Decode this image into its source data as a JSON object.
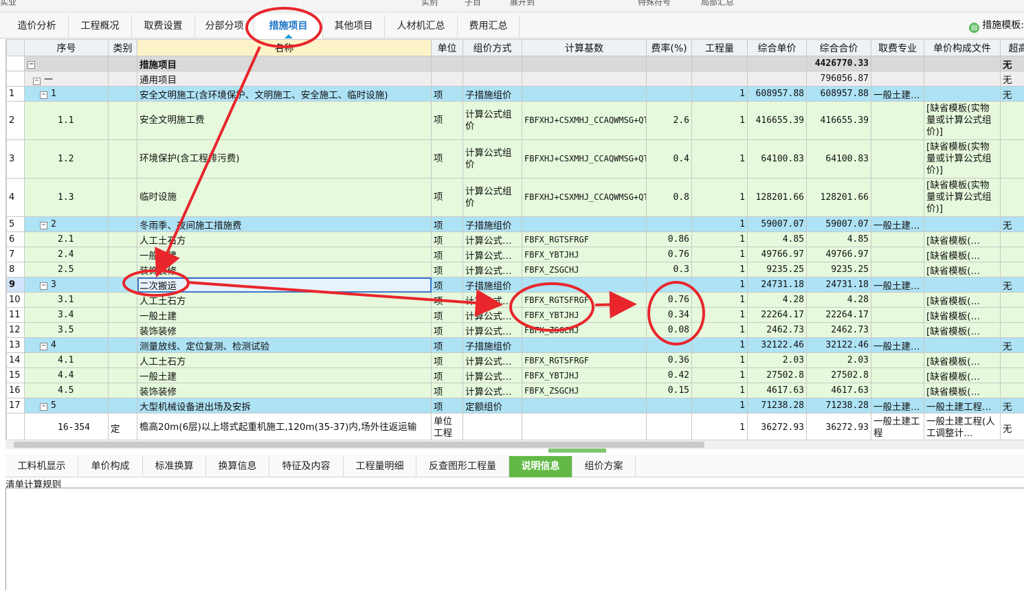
{
  "topbar": {
    "items": [
      "实业",
      "实别",
      "子目",
      "展开到",
      "特殊符号",
      "局部汇总"
    ]
  },
  "tabs": [
    {
      "label": "造价分析",
      "active": false
    },
    {
      "label": "工程概况",
      "active": false
    },
    {
      "label": "取费设置",
      "active": false
    },
    {
      "label": "分部分项",
      "active": false
    },
    {
      "label": "措施项目",
      "active": true
    },
    {
      "label": "其他项目",
      "active": false
    },
    {
      "label": "人材机汇总",
      "active": false
    },
    {
      "label": "费用汇总",
      "active": false
    }
  ],
  "template_label": "措施模板:",
  "columns": [
    "序号",
    "类别",
    "名称",
    "单位",
    "组价方式",
    "计算基数",
    "费率(%)",
    "工程量",
    "综合单价",
    "综合合价",
    "取费专业",
    "单价构成文件",
    "超高"
  ],
  "rows": [
    {
      "rn": "",
      "lvl": "lvl0",
      "seq": "",
      "type": "",
      "name": "措施项目",
      "unit": "",
      "method": "",
      "base": "",
      "rate": "",
      "qty": "",
      "uprice": "",
      "total": "4426770.33",
      "spec": "",
      "file": "",
      "extra": "无"
    },
    {
      "rn": "",
      "lvl": "lvl1",
      "seq": "一",
      "type": "",
      "name": "通用项目",
      "unit": "",
      "method": "",
      "base": "",
      "rate": "",
      "qty": "",
      "uprice": "",
      "total": "796056.87",
      "spec": "",
      "file": "",
      "extra": "无"
    },
    {
      "rn": "1",
      "lvl": "lvlB",
      "seq": "1",
      "type": "",
      "name": "安全文明施工(含环境保护、文明施工、安全施工、临时设施)",
      "unit": "项",
      "method": "子措施组价",
      "base": "",
      "rate": "",
      "qty": "1",
      "uprice": "608957.88",
      "total": "608957.88",
      "spec": "一般土建…",
      "file": "",
      "extra": "无"
    },
    {
      "rn": "2",
      "lvl": "lvlG",
      "seq": "1.1",
      "type": "",
      "name": "安全文明施工费",
      "unit": "项",
      "method": "计算公式组价",
      "base": "FBFXHJ+CSXMHJ_CCAQWMSG+QTXMHJ+FBFXRGCJ+CSXMRGCJ+QTXMRGCJ",
      "rate": "2.6",
      "qty": "1",
      "uprice": "416655.39",
      "total": "416655.39",
      "spec": "",
      "file": "[缺省模板(实物量或计算公式组价)]",
      "extra": ""
    },
    {
      "rn": "3",
      "lvl": "lvlG",
      "seq": "1.2",
      "type": "",
      "name": "环境保护(含工程排污费)",
      "unit": "项",
      "method": "计算公式组价",
      "base": "FBFXHJ+CSXMHJ_CCAQWMSG+QTXMHJ+FBFXRGCJ+CSXMRGCJ+QTXMRGCJ",
      "rate": "0.4",
      "qty": "1",
      "uprice": "64100.83",
      "total": "64100.83",
      "spec": "",
      "file": "[缺省模板(实物量或计算公式组价)]",
      "extra": ""
    },
    {
      "rn": "4",
      "lvl": "lvlG",
      "seq": "1.3",
      "type": "",
      "name": "临时设施",
      "unit": "项",
      "method": "计算公式组价",
      "base": "FBFXHJ+CSXMHJ_CCAQWMSG+QTXMHJ+FBFXRGCJ+CSXMRGCJ+QTXMRGCJ",
      "rate": "0.8",
      "qty": "1",
      "uprice": "128201.66",
      "total": "128201.66",
      "spec": "",
      "file": "[缺省模板(实物量或计算公式组价)]",
      "extra": ""
    },
    {
      "rn": "5",
      "lvl": "lvlB",
      "seq": "2",
      "type": "",
      "name": "冬雨季、夜间施工措施费",
      "unit": "项",
      "method": "子措施组价",
      "base": "",
      "rate": "",
      "qty": "1",
      "uprice": "59007.07",
      "total": "59007.07",
      "spec": "一般土建…",
      "file": "",
      "extra": "无"
    },
    {
      "rn": "6",
      "lvl": "lvlG",
      "seq": "2.1",
      "type": "",
      "name": "人工土石方",
      "unit": "项",
      "method": "计算公式…",
      "base": "FBFX_RGTSFRGF",
      "rate": "0.86",
      "qty": "1",
      "uprice": "4.85",
      "total": "4.85",
      "spec": "",
      "file": "[缺省模板(…",
      "extra": ""
    },
    {
      "rn": "7",
      "lvl": "lvlG",
      "seq": "2.4",
      "type": "",
      "name": "一般土建",
      "unit": "项",
      "method": "计算公式…",
      "base": "FBFX_YBTJHJ",
      "rate": "0.76",
      "qty": "1",
      "uprice": "49766.97",
      "total": "49766.97",
      "spec": "",
      "file": "[缺省模板(…",
      "extra": ""
    },
    {
      "rn": "8",
      "lvl": "lvlG",
      "seq": "2.5",
      "type": "",
      "name": "装饰装修",
      "unit": "项",
      "method": "计算公式…",
      "base": "FBFX_ZSGCHJ",
      "rate": "0.3",
      "qty": "1",
      "uprice": "9235.25",
      "total": "9235.25",
      "spec": "",
      "file": "[缺省模板(…",
      "extra": ""
    },
    {
      "rn": "9",
      "lvl": "lvlB",
      "sel": true,
      "seq": "3",
      "type": "",
      "name": "二次搬运",
      "unit": "项",
      "method": "子措施组价",
      "base": "",
      "rate": "",
      "qty": "1",
      "uprice": "24731.18",
      "total": "24731.18",
      "spec": "一般土建…",
      "file": "",
      "extra": "无"
    },
    {
      "rn": "10",
      "lvl": "lvlG",
      "seq": "3.1",
      "type": "",
      "name": "人工土石方",
      "unit": "项",
      "method": "计算公式…",
      "base": "FBFX_RGTSFRGF",
      "rate": "0.76",
      "qty": "1",
      "uprice": "4.28",
      "total": "4.28",
      "spec": "",
      "file": "[缺省模板(…",
      "extra": ""
    },
    {
      "rn": "11",
      "lvl": "lvlG",
      "seq": "3.4",
      "type": "",
      "name": "一般土建",
      "unit": "项",
      "method": "计算公式…",
      "base": "FBFX_YBTJHJ",
      "rate": "0.34",
      "qty": "1",
      "uprice": "22264.17",
      "total": "22264.17",
      "spec": "",
      "file": "[缺省模板(…",
      "extra": ""
    },
    {
      "rn": "12",
      "lvl": "lvlG",
      "seq": "3.5",
      "type": "",
      "name": "装饰装修",
      "unit": "项",
      "method": "计算公式…",
      "base": "FBFX_ZSGCHJ",
      "rate": "0.08",
      "qty": "1",
      "uprice": "2462.73",
      "total": "2462.73",
      "spec": "",
      "file": "[缺省模板(…",
      "extra": ""
    },
    {
      "rn": "13",
      "lvl": "lvlB",
      "seq": "4",
      "type": "",
      "name": "测量放线、定位复测、检测试验",
      "unit": "项",
      "method": "子措施组价",
      "base": "",
      "rate": "",
      "qty": "1",
      "uprice": "32122.46",
      "total": "32122.46",
      "spec": "一般土建…",
      "file": "",
      "extra": "无"
    },
    {
      "rn": "14",
      "lvl": "lvlG",
      "seq": "4.1",
      "type": "",
      "name": "人工土石方",
      "unit": "项",
      "method": "计算公式…",
      "base": "FBFX_RGTSFRGF",
      "rate": "0.36",
      "qty": "1",
      "uprice": "2.03",
      "total": "2.03",
      "spec": "",
      "file": "[缺省模板(…",
      "extra": ""
    },
    {
      "rn": "15",
      "lvl": "lvlG",
      "seq": "4.4",
      "type": "",
      "name": "一般土建",
      "unit": "项",
      "method": "计算公式…",
      "base": "FBFX_YBTJHJ",
      "rate": "0.42",
      "qty": "1",
      "uprice": "27502.8",
      "total": "27502.8",
      "spec": "",
      "file": "[缺省模板(…",
      "extra": ""
    },
    {
      "rn": "16",
      "lvl": "lvlG",
      "seq": "4.5",
      "type": "",
      "name": "装饰装修",
      "unit": "项",
      "method": "计算公式…",
      "base": "FBFX_ZSGCHJ",
      "rate": "0.15",
      "qty": "1",
      "uprice": "4617.63",
      "total": "4617.63",
      "spec": "",
      "file": "[缺省模板(…",
      "extra": ""
    },
    {
      "rn": "17",
      "lvl": "lvlB",
      "seq": "5",
      "type": "",
      "name": "大型机械设备进出场及安拆",
      "unit": "项",
      "method": "定额组价",
      "base": "",
      "rate": "",
      "qty": "1",
      "uprice": "71238.28",
      "total": "71238.28",
      "spec": "一般土建…",
      "file": "一般土建工程…",
      "extra": "无"
    },
    {
      "rn": "",
      "lvl": "lvlW",
      "seq": "16-354",
      "type": "定",
      "name": "檐高20m(6层)以上塔式起重机施工,120m(35-37)内,场外往返运输",
      "unit": "单位工程",
      "method": "",
      "base": "",
      "rate": "",
      "qty": "1",
      "uprice": "36272.93",
      "total": "36272.93",
      "spec": "一般土建工程",
      "file": "一般土建工程(人工调整计…",
      "extra": "无"
    }
  ],
  "bottom_tabs": [
    {
      "label": "工料机显示",
      "active": false
    },
    {
      "label": "单价构成",
      "active": false
    },
    {
      "label": "标准换算",
      "active": false
    },
    {
      "label": "换算信息",
      "active": false
    },
    {
      "label": "特征及内容",
      "active": false
    },
    {
      "label": "工程量明细",
      "active": false
    },
    {
      "label": "反查图形工程量",
      "active": false
    },
    {
      "label": "说明信息",
      "active": true
    },
    {
      "label": "组价方案",
      "active": false
    }
  ],
  "rule_label": "清单计算规则",
  "colors": {
    "accent": "#1a73c8",
    "annotation": "#e8262c",
    "green_tab": "#63b946",
    "row_blue": "#aee2f5",
    "row_green": "#e6f9dc"
  }
}
